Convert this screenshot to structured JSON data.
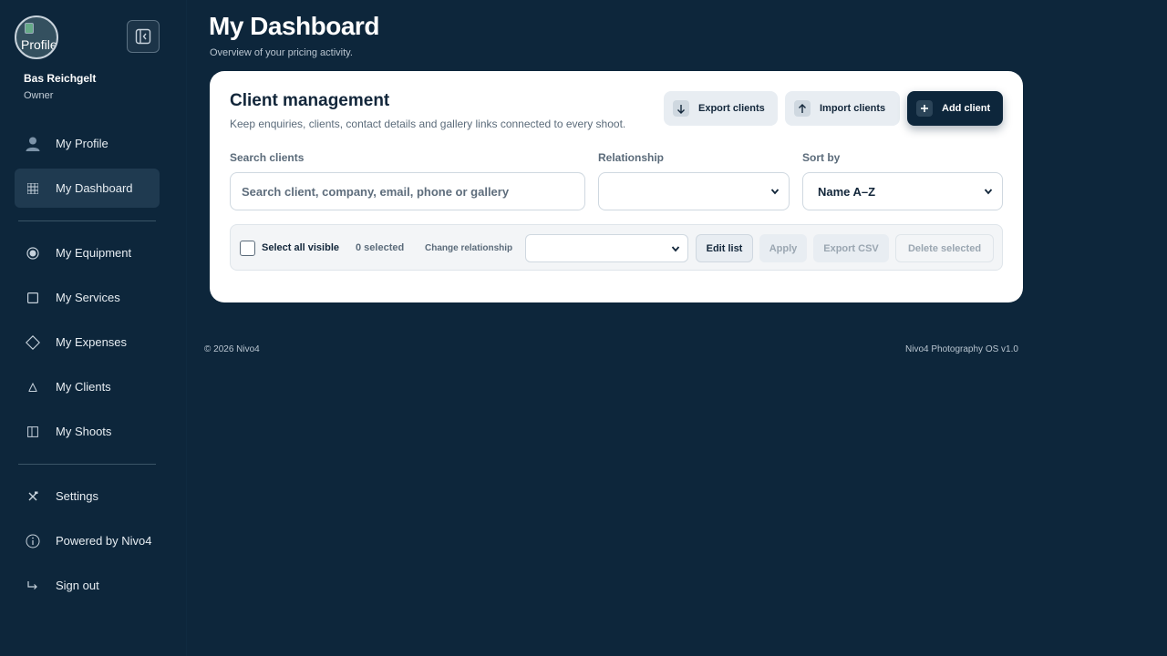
{
  "sidebar": {
    "avatar_alt": "Profile",
    "user_name": "Bas Reichgelt",
    "user_role": "Owner",
    "primary_items": [
      {
        "label": "My Profile",
        "icon": "user-icon"
      },
      {
        "label": "My Dashboard",
        "icon": "grid-icon",
        "active": true
      }
    ],
    "secondary_items": [
      {
        "label": "My Equipment",
        "icon": "radio-icon"
      },
      {
        "label": "My Services",
        "icon": "square-icon"
      },
      {
        "label": "My Expenses",
        "icon": "diamond-icon"
      },
      {
        "label": "My Clients",
        "icon": "clients-icon"
      },
      {
        "label": "My Shoots",
        "icon": "shoots-icon"
      }
    ],
    "footer_items": [
      {
        "label": "Settings",
        "icon": "tools-icon"
      },
      {
        "label": "Powered by Nivo4",
        "icon": "info-icon"
      },
      {
        "label": "Sign out",
        "icon": "sign-out-icon"
      }
    ]
  },
  "header": {
    "title": "My Dashboard",
    "subtitle": "Overview of your pricing activity."
  },
  "card": {
    "title": "Client management",
    "subtitle": "Keep enquiries, clients, contact details and gallery links connected to every shoot.",
    "export_label": "Export clients",
    "import_label": "Import clients",
    "add_label": "Add client",
    "search_label": "Search clients",
    "search_placeholder": "Search client, company, email, phone or gallery",
    "relationship_label": "Relationship",
    "relationship_value": "",
    "sort_label": "Sort by",
    "sort_value": "Name A–Z"
  },
  "bulk": {
    "select_all_label": "Select all visible",
    "selected_count": "0 selected",
    "change_relationship_label": "Change relationship",
    "edit_list_label": "Edit list",
    "apply_label": "Apply",
    "export_csv_label": "Export CSV",
    "delete_label": "Delete selected"
  },
  "footer": {
    "copyright": "© 2026 Nivo4",
    "version": "Nivo4 Photography OS v1.0"
  },
  "colors": {
    "background": "#0d263b",
    "card": "#ffffff",
    "active_nav": "#1f3a50",
    "primary_button": "#0d263b"
  }
}
